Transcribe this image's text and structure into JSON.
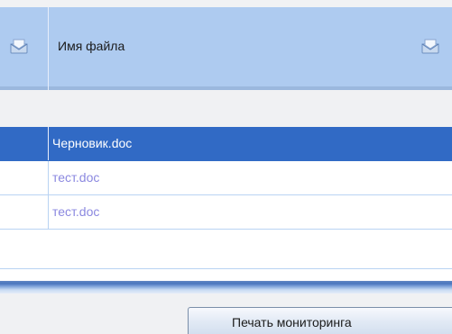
{
  "header": {
    "column_label": "Имя файла",
    "left_icon": "sort-envelope-icon",
    "right_icon": "sort-envelope-icon"
  },
  "files": [
    {
      "name": "Черновик.doc",
      "selected": true
    },
    {
      "name": "тест.doc",
      "selected": false
    },
    {
      "name": "тест.doc",
      "selected": false
    }
  ],
  "footer": {
    "print_button_label": "Печать мониторинга"
  },
  "colors": {
    "header_bg": "#aecbf0",
    "selection": "#316ac5",
    "file_link": "#8b88e0"
  }
}
